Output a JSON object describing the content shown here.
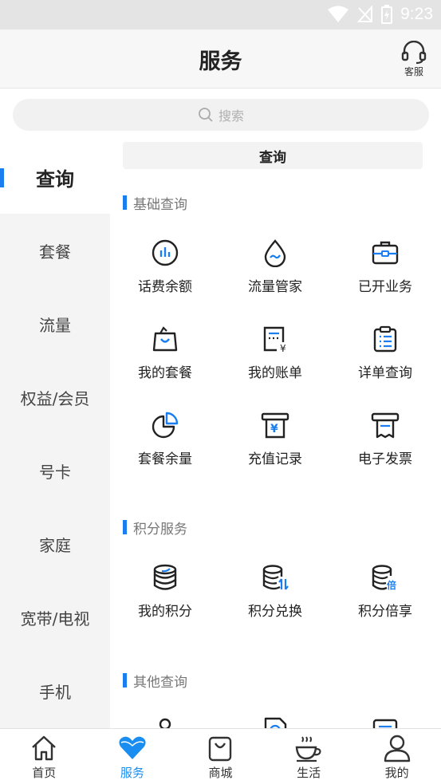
{
  "status_bar": {
    "time": "9:23"
  },
  "header": {
    "title": "服务",
    "service_label": "客服"
  },
  "search": {
    "placeholder": "搜索"
  },
  "sidebar": {
    "items": [
      {
        "label": "查询",
        "active": true
      },
      {
        "label": "套餐"
      },
      {
        "label": "流量"
      },
      {
        "label": "权益/会员"
      },
      {
        "label": "号卡"
      },
      {
        "label": "家庭"
      },
      {
        "label": "宽带/电视"
      },
      {
        "label": "手机"
      }
    ]
  },
  "main": {
    "tab_label": "查询",
    "sections": [
      {
        "title": "基础查询",
        "items": [
          {
            "label": "话费余额",
            "icon": "chart-circle-icon"
          },
          {
            "label": "流量管家",
            "icon": "drop-icon"
          },
          {
            "label": "已开业务",
            "icon": "briefcase-icon"
          },
          {
            "label": "我的套餐",
            "icon": "shopping-bag-icon"
          },
          {
            "label": "我的账单",
            "icon": "bill-icon"
          },
          {
            "label": "详单查询",
            "icon": "clipboard-list-icon"
          },
          {
            "label": "套餐余量",
            "icon": "pie-chart-icon"
          },
          {
            "label": "充值记录",
            "icon": "recharge-icon"
          },
          {
            "label": "电子发票",
            "icon": "invoice-icon"
          }
        ]
      },
      {
        "title": "积分服务",
        "items": [
          {
            "label": "我的积分",
            "icon": "coin-stack-icon"
          },
          {
            "label": "积分兑换",
            "icon": "points-exchange-icon"
          },
          {
            "label": "积分倍享",
            "icon": "points-multiply-icon",
            "badge": "倍"
          }
        ]
      },
      {
        "title": "其他查询",
        "items": [
          {
            "label": "",
            "icon": "person-icon"
          },
          {
            "label": "",
            "icon": "document-icon"
          },
          {
            "label": "",
            "icon": "list-card-icon"
          }
        ]
      }
    ]
  },
  "bottom_nav": {
    "items": [
      {
        "label": "首页",
        "icon": "home-icon"
      },
      {
        "label": "服务",
        "icon": "heart-icon",
        "active": true
      },
      {
        "label": "商城",
        "icon": "bag-icon"
      },
      {
        "label": "生活",
        "icon": "coffee-cup-icon"
      },
      {
        "label": "我的",
        "icon": "user-icon"
      }
    ]
  },
  "colors": {
    "accent": "#1a7ef0",
    "active_nav": "#1a8ef0"
  }
}
